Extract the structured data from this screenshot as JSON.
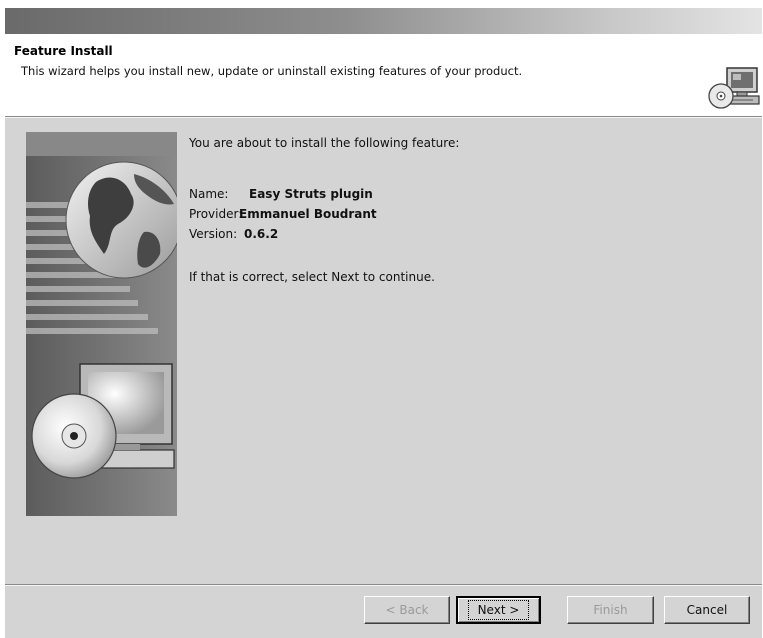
{
  "header": {
    "title": "Feature Install",
    "description": "This wizard helps you install new, update or uninstall existing features of your product.",
    "icon": "computer-cd-icon"
  },
  "side_graphic": {
    "icon": "globe-cd-monitor-illustration"
  },
  "content": {
    "intro": "You are about to install the following feature:",
    "name_label": "Name:",
    "name_value": "Easy Struts plugin",
    "provider_label": "Provider:",
    "provider_value": "Emmanuel Boudrant",
    "version_label": "Version:",
    "version_value": "0.6.2",
    "confirm": "If that is correct, select Next to continue."
  },
  "buttons": {
    "back": "< Back",
    "next": "Next >",
    "finish": "Finish",
    "cancel": "Cancel"
  },
  "colors": {
    "dialog_background": "#d4d4d4",
    "header_background": "#ffffff",
    "disabled_text": "#9a9a9a"
  }
}
